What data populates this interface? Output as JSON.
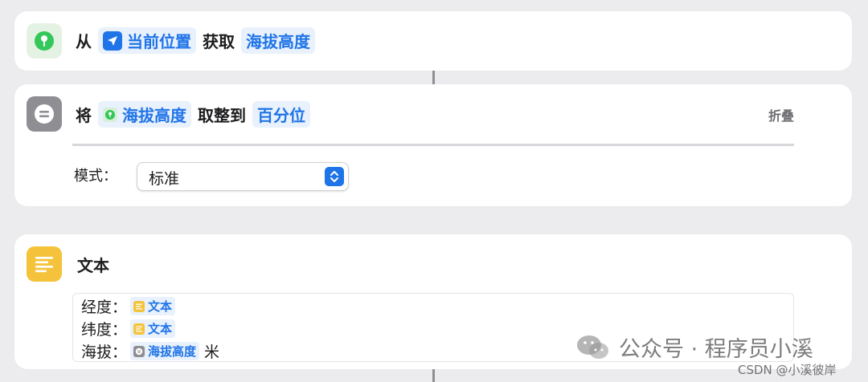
{
  "colors": {
    "accent": "#1f74e8",
    "location_green": "#34c759",
    "round_gray": "#8e8e93",
    "text_yellow": "#f5c33b"
  },
  "action1": {
    "icon": "location-pin-icon",
    "from_label": "从",
    "source_token": "当前位置",
    "source_icon": "location-arrow-icon",
    "get_label": "获取",
    "detail_token": "海拔高度"
  },
  "action2": {
    "icon": "round-number-icon",
    "prefix": "将",
    "input_token": "海拔高度",
    "input_icon": "location-pin-icon",
    "round_label": "取整到",
    "precision_token": "百分位",
    "collapse_label": "折叠",
    "mode_label": "模式：",
    "mode_value": "标准"
  },
  "action3": {
    "icon": "text-icon",
    "title": "文本",
    "lines": [
      {
        "label": "经度：",
        "var": "文本",
        "var_icon": "text-icon",
        "suffix": ""
      },
      {
        "label": "纬度：",
        "var": "文本",
        "var_icon": "text-icon",
        "suffix": ""
      },
      {
        "label": "海拔：",
        "var": "海拔高度",
        "var_icon": "round-number-icon",
        "suffix": "米"
      }
    ]
  },
  "watermark": {
    "text": "公众号 · 程序员小溪",
    "icon": "wechat-icon"
  },
  "csdn": "CSDN @小溪彼岸"
}
